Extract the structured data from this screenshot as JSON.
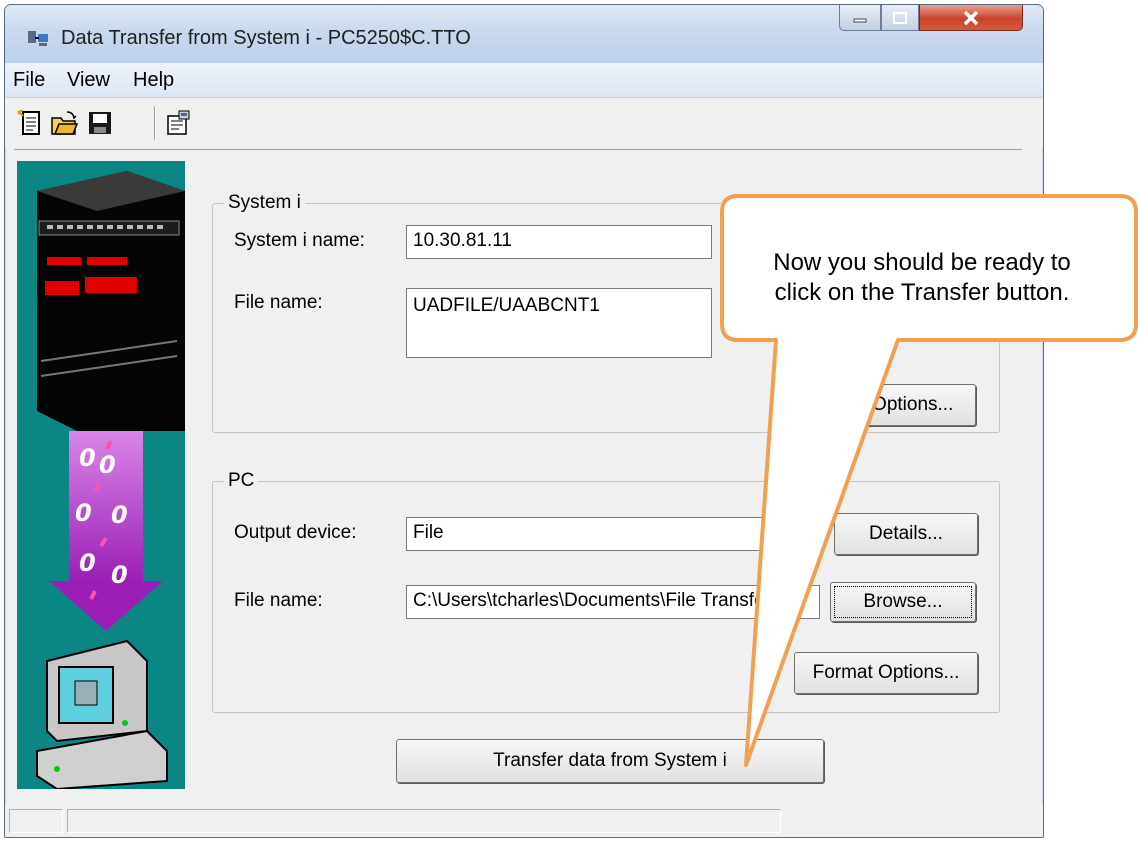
{
  "window": {
    "title": "Data Transfer from System i - PC5250$C.TTO",
    "app_icon": "transfer-app-icon",
    "controls": [
      "minimize-icon",
      "maximize-icon",
      "close-icon"
    ]
  },
  "menu": {
    "file": "File",
    "view": "View",
    "help": "Help"
  },
  "toolbar": {
    "icons": [
      "new-document-icon",
      "open-folder-icon",
      "save-disk-icon",
      "properties-icon"
    ]
  },
  "system_group": {
    "legend": "System i",
    "name_label": "System i name:",
    "name_value": "10.30.81.11",
    "file_label": "File name:",
    "file_value": "UADFILE/UAABCNT1",
    "options_label": "Data Options..."
  },
  "pc_group": {
    "legend": "PC",
    "output_label": "Output device:",
    "output_value": "File",
    "details_label": "Details...",
    "file_label": "File name:",
    "file_value": "C:\\Users\\tcharles\\Documents\\File Transfers\\(",
    "browse_label": "Browse...",
    "format_label": "Format Options..."
  },
  "transfer_label": "Transfer data from System i",
  "callout": {
    "line1": "Now you should be ready to",
    "line2": "click on the Transfer button."
  },
  "colors": {
    "callout_border": "#f0a050",
    "side_art": "#0a8784",
    "accent": "#9b1fb5"
  }
}
